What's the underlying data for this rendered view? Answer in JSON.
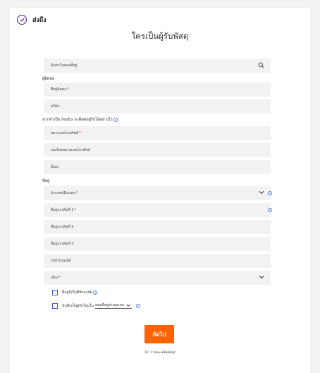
{
  "header": {
    "title": "ส่งถึง"
  },
  "form_title": "ใครเป็นผู้รับพัสดุ",
  "search": {
    "placeholder": "ค้นหาในสมุดที่อยู่"
  },
  "contact_section": {
    "label": "ผู้ติดต่อ",
    "contact_name_label": "ชื่อผู้ติดต่อ",
    "company_label": "บริษัท"
  },
  "contact_method": {
    "label": "หากจำเป็น FedEx จะติดต่อผู้รับได้อย่างไร",
    "phone_label": "หมายเลขโทรศัพท์",
    "extension_label": "เบอร์ต่อหมายเลขโทรศัพท์",
    "email_label": "อีเมล"
  },
  "address_section": {
    "label": "ที่อยู่",
    "country_label": "ประเทศ/ดินแดน",
    "line1_label": "ที่อยู่บรรทัดที่ 1",
    "line2_label": "ที่อยู่บรรทัดที่ 2",
    "line3_label": "ที่อยู่บรรทัดที่ 3",
    "postal_label": "รหัสไปรษณีย์",
    "city_label": "เมือง"
  },
  "required_mark": "*",
  "options": {
    "residential_label": "ที่อยู่นี้เป็นที่พักอาศัย",
    "save_prefix": "บันทึกเป็นผู้รับใหม่ใน",
    "save_target": "สมุดที่อยู่ส่วนบุคคล"
  },
  "next_button_label": "ถัดไป",
  "next_hint": "ถึง 'รายละเอียดพัสดุ'",
  "colors": {
    "accent": "#4d148c",
    "button": "#ff6200",
    "info": "#5b74e0",
    "checkbox": "#3b5bdb",
    "field_bg": "#f2f2f2"
  }
}
